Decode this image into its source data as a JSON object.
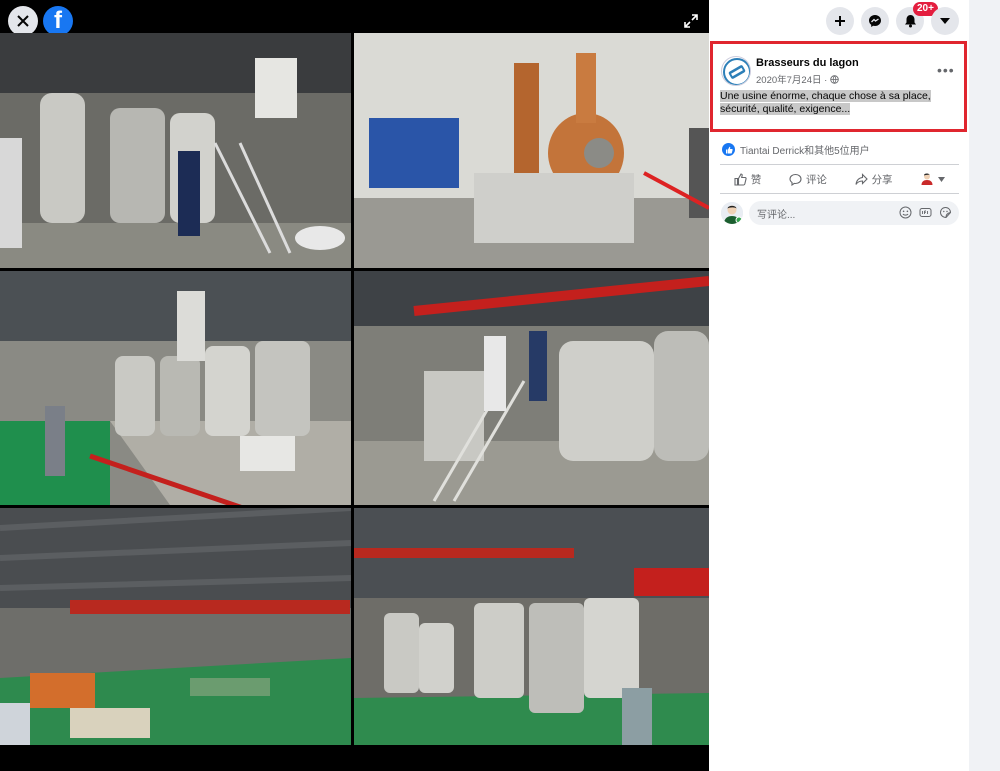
{
  "viewer": {
    "close_icon": "close-icon",
    "logo": "f",
    "expand_icon": "expand-icon",
    "photos": [
      {
        "scene": "brewhouse-platform"
      },
      {
        "scene": "copper-still"
      },
      {
        "scene": "tank-hall-red-barrier"
      },
      {
        "scene": "brewhouse-stairs"
      },
      {
        "scene": "warehouse-forklift"
      },
      {
        "scene": "fermenter-row"
      }
    ]
  },
  "topnav": {
    "create_icon": "plus-icon",
    "messenger_icon": "messenger-icon",
    "notifications_icon": "bell-icon",
    "notifications_badge": "20+",
    "account_icon": "caret-down-icon"
  },
  "post": {
    "page_name": "Brasseurs du lagon",
    "date": "2020年7月24日 · ",
    "privacy_icon": "globe-icon",
    "more_label": "•••",
    "text": "Une usine énorme, chaque chose à sa place, sécurité, qualité, exigence...",
    "reactions_text": "Tiantai Derrick和其他5位用户"
  },
  "actions": {
    "like": "赞",
    "comment": "评论",
    "share": "分享"
  },
  "comment": {
    "placeholder": "写评论...",
    "emoji_icon": "emoji-icon",
    "gif_icon": "gif-icon",
    "sticker_icon": "sticker-icon"
  },
  "colors": {
    "brand": "#1877f2",
    "highlight": "#e0262f",
    "badge": "#e41e3f"
  }
}
